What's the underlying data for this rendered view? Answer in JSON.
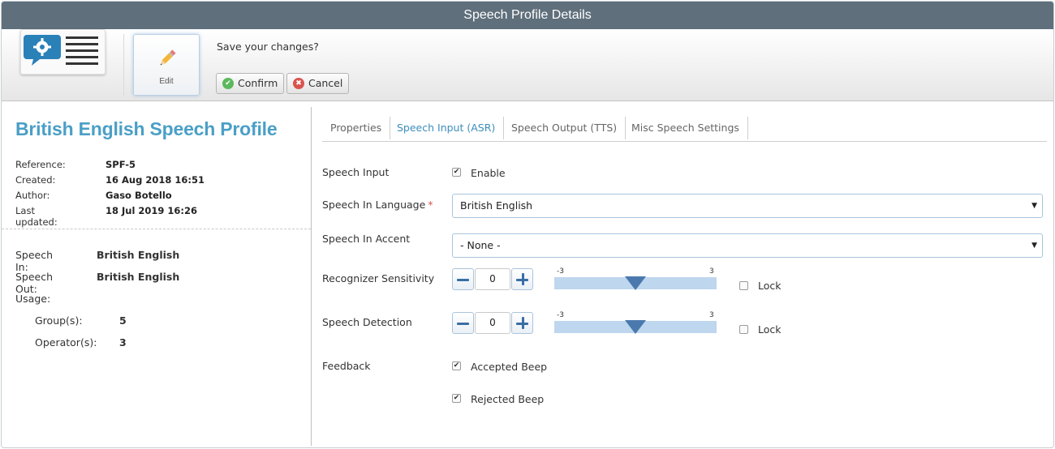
{
  "window": {
    "title": "Speech Profile Details"
  },
  "toolbar": {
    "app_icon": "speech-settings-icon",
    "edit_label": "Edit",
    "save_prompt": "Save your changes?",
    "confirm_label": "Confirm",
    "cancel_label": "Cancel",
    "confirm_color": "#5cb85c",
    "cancel_color": "#d9534f"
  },
  "profile": {
    "title": "British English Speech Profile",
    "meta": [
      {
        "key": "Reference:",
        "value": "SPF-5"
      },
      {
        "key": "Created:",
        "value": "16 Aug 2018 16:51"
      },
      {
        "key": "Author:",
        "value": "Gaso Botello"
      },
      {
        "key": "Last updated:",
        "value": "18 Jul 2019 16:26"
      }
    ],
    "speech_in_label": "Speech In:",
    "speech_in": "British English",
    "speech_out_label": "Speech Out:",
    "speech_out": "British English",
    "usage_label": "Usage:",
    "groups_label": "Group(s):",
    "groups": "5",
    "operators_label": "Operator(s):",
    "operators": "3"
  },
  "tabs": [
    {
      "label": "Properties",
      "active": false
    },
    {
      "label": "Speech Input (ASR)",
      "active": true
    },
    {
      "label": "Speech Output (TTS)",
      "active": false
    },
    {
      "label": "Misc Speech Settings",
      "active": false
    }
  ],
  "accent_color": "#4a9fc7",
  "form": {
    "speech_input": {
      "label": "Speech Input",
      "checkbox_label": "Enable",
      "checked": true
    },
    "language": {
      "label": "Speech In Language",
      "required_mark": "*",
      "value": "British English"
    },
    "accent": {
      "label": "Speech In Accent",
      "value": "- None -"
    },
    "sensitivity": {
      "label": "Recognizer Sensitivity",
      "value": "0",
      "min_label": "-3",
      "max_label": "3",
      "min": -3,
      "max": 3,
      "level": 0,
      "lock_label": "Lock",
      "locked": false
    },
    "detection": {
      "label": "Speech Detection",
      "value": "0",
      "min_label": "-3",
      "max_label": "3",
      "min": -3,
      "max": 3,
      "level": 0,
      "lock_label": "Lock",
      "locked": false
    },
    "feedback": {
      "label": "Feedback",
      "accepted_label": "Accepted Beep",
      "accepted_checked": true,
      "rejected_label": "Rejected Beep",
      "rejected_checked": true
    }
  }
}
